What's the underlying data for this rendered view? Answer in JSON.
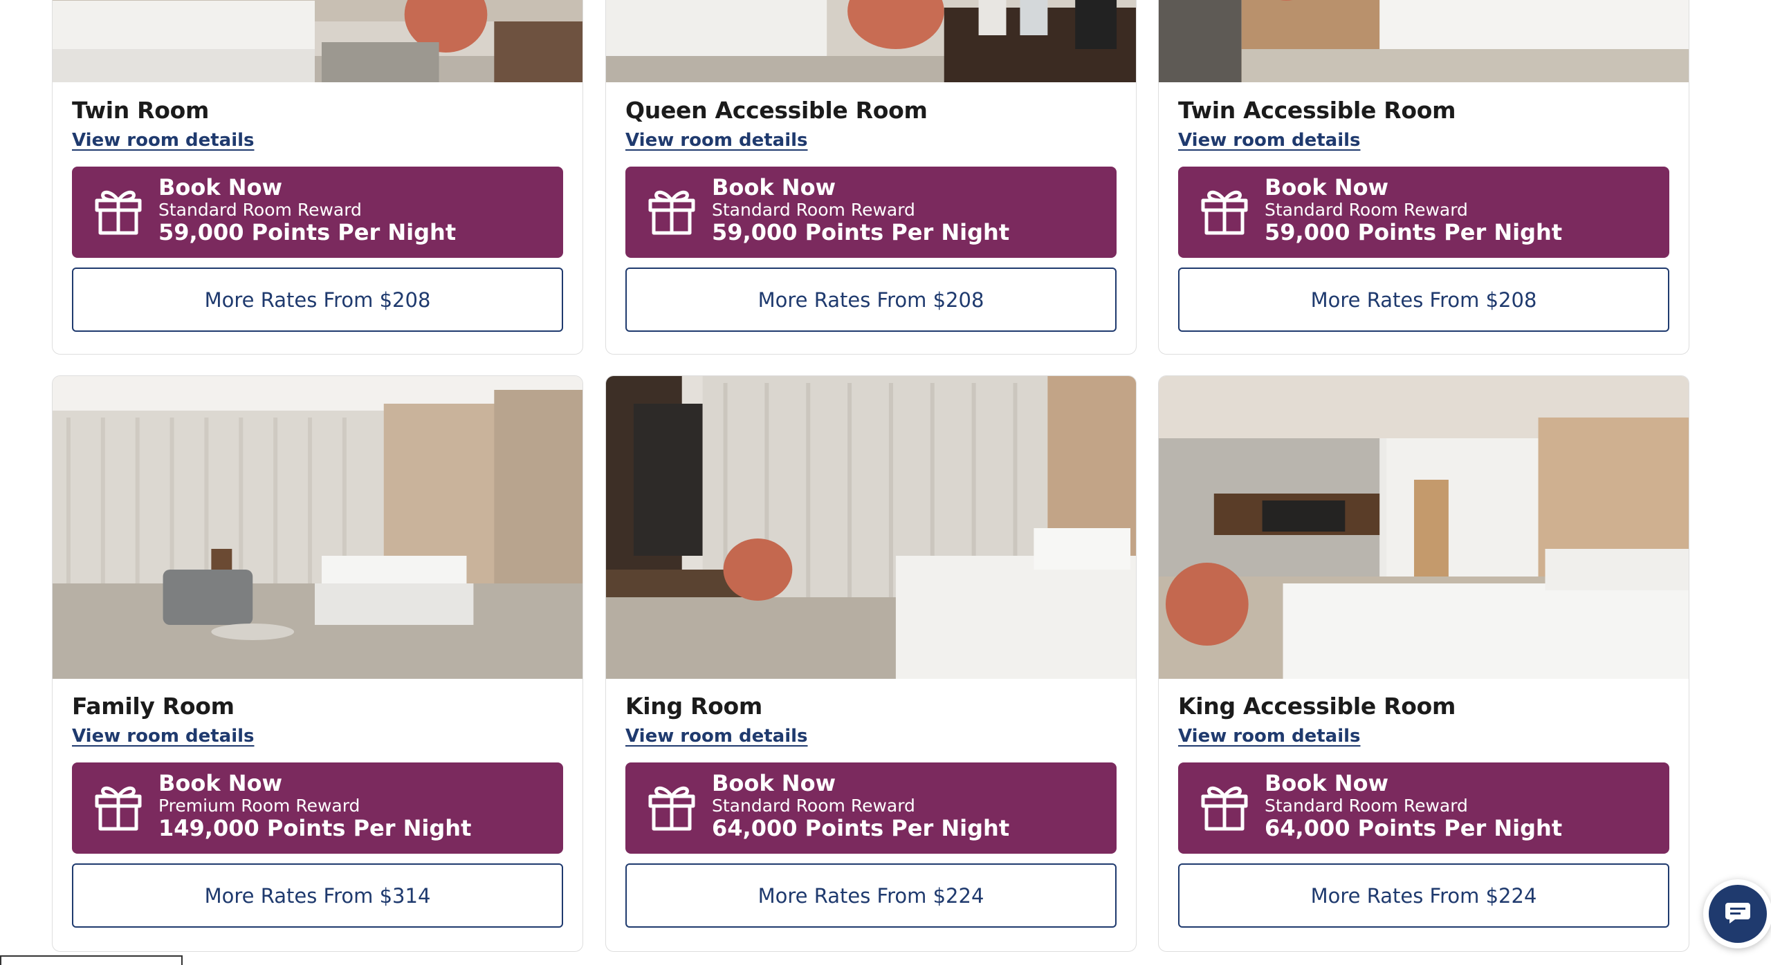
{
  "rooms": [
    {
      "name": "Twin Room",
      "details_link": "View room details",
      "book_title": "Book Now",
      "reward_type": "Standard Room Reward",
      "points": "59,000 Points Per Night",
      "more_rates": "More Rates From $208"
    },
    {
      "name": "Queen Accessible Room",
      "details_link": "View room details",
      "book_title": "Book Now",
      "reward_type": "Standard Room Reward",
      "points": "59,000 Points Per Night",
      "more_rates": "More Rates From $208"
    },
    {
      "name": "Twin Accessible Room",
      "details_link": "View room details",
      "book_title": "Book Now",
      "reward_type": "Standard Room Reward",
      "points": "59,000 Points Per Night",
      "more_rates": "More Rates From $208"
    },
    {
      "name": "Family Room",
      "details_link": "View room details",
      "book_title": "Book Now",
      "reward_type": "Premium Room Reward",
      "points": "149,000 Points Per Night",
      "more_rates": "More Rates From $314"
    },
    {
      "name": "King Room",
      "details_link": "View room details",
      "book_title": "Book Now",
      "reward_type": "Standard Room Reward",
      "points": "64,000 Points Per Night",
      "more_rates": "More Rates From $224"
    },
    {
      "name": "King Accessible Room",
      "details_link": "View room details",
      "book_title": "Book Now",
      "reward_type": "Standard Room Reward",
      "points": "64,000 Points Per Night",
      "more_rates": "More Rates From $224"
    }
  ],
  "icons": {
    "reward": "gift-icon",
    "chat": "chat-bubble-icon"
  },
  "colors": {
    "reward_bg": "#7b2a5e",
    "link": "#1f3a6e",
    "card_border": "#dedede"
  }
}
